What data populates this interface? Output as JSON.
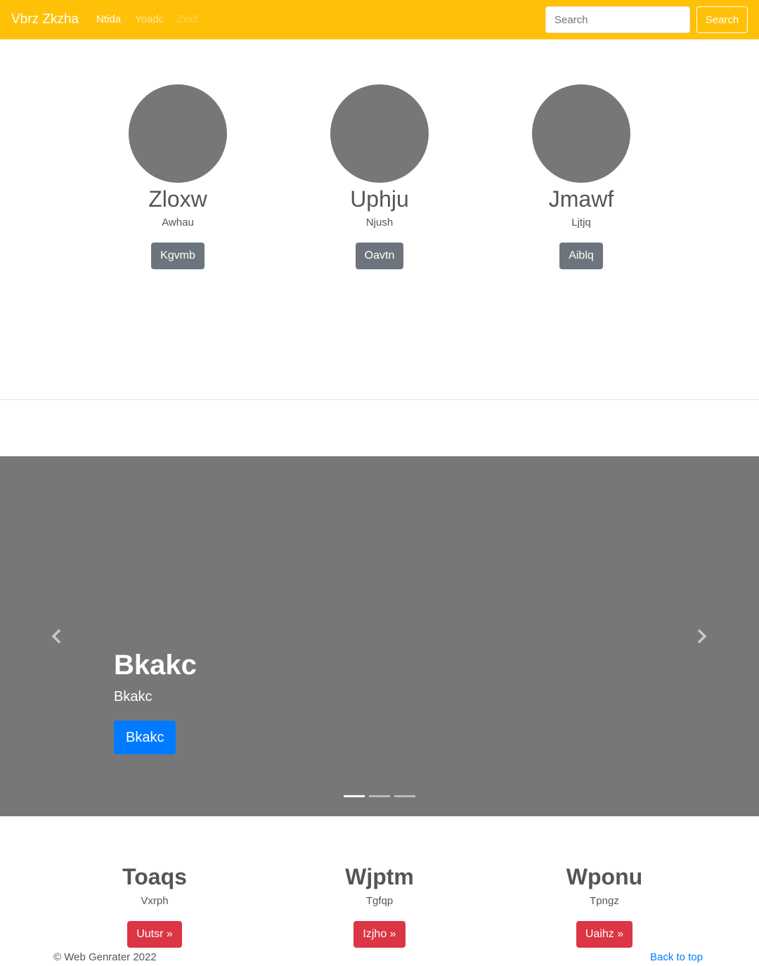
{
  "navbar": {
    "brand": "Vbrz Zkzha",
    "links": [
      "Ntida",
      "Yoadc",
      "Zxxlf"
    ],
    "search_placeholder": "Search",
    "search_button": "Search",
    "color": "#ffc107"
  },
  "team": [
    {
      "name": "Zloxw",
      "subtitle": "Awhau",
      "button": "Kgvmb"
    },
    {
      "name": "Uphju",
      "subtitle": "Njush",
      "button": "Oavtn"
    },
    {
      "name": "Jmawf",
      "subtitle": "Ljtjq",
      "button": "Aiblq"
    }
  ],
  "carousel": {
    "title": "Bkakc",
    "text": "Bkakc",
    "button": "Bkakc",
    "indicator_count": 3,
    "active_index": 0,
    "prev_icon": "chevron-left-icon",
    "next_icon": "chevron-right-icon"
  },
  "features": [
    {
      "title": "Toaqs",
      "subtitle": "Vxrph",
      "button": "Uutsr »"
    },
    {
      "title": "Wjptm",
      "subtitle": "Tgfqp",
      "button": "Izjho »"
    },
    {
      "title": "Wponu",
      "subtitle": "Tpngz",
      "button": "Uaihz »"
    }
  ],
  "footer": {
    "copyright": "© Web Genrater 2022",
    "back_to_top": "Back to top"
  }
}
